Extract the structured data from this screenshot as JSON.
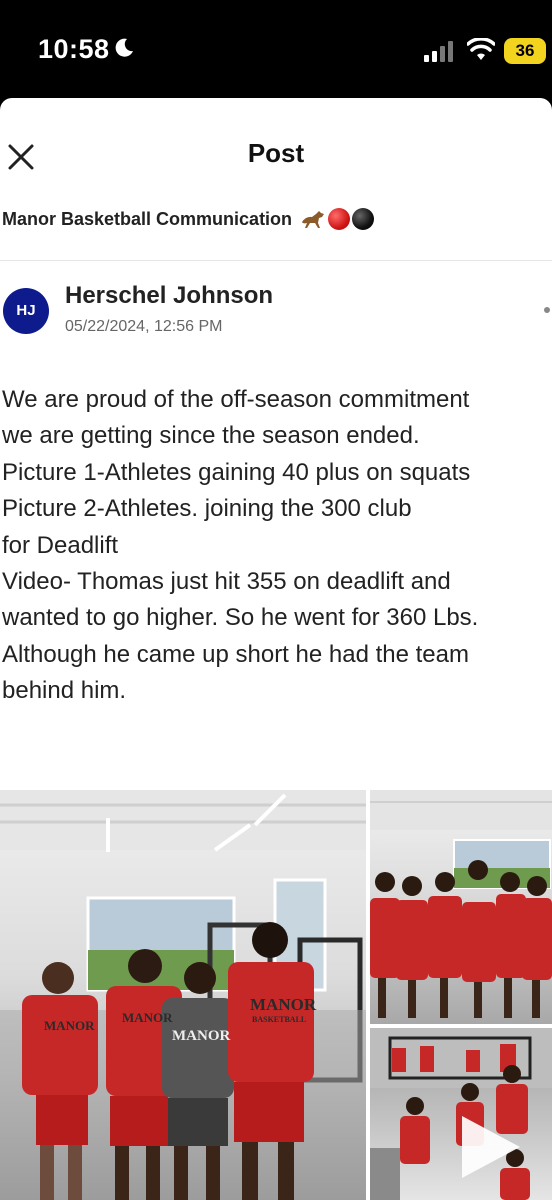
{
  "status_bar": {
    "time": "10:58",
    "battery": "36",
    "icons": [
      "moon-icon",
      "signal-icon",
      "wifi-icon",
      "battery-icon"
    ]
  },
  "header": {
    "title": "Post",
    "close_icon": "close-icon"
  },
  "group": {
    "name": "Manor Basketball Communication",
    "emojis": [
      "horse",
      "red-ball",
      "black-ball"
    ]
  },
  "post": {
    "avatar_initials": "HJ",
    "author": "Herschel Johnson",
    "timestamp": "05/22/2024, 12:56 PM",
    "body_lines": [
      "We are proud of the off-season commitment",
      "we are getting since the season ended.",
      "Picture 1-Athletes gaining 40 plus on squats",
      "Picture 2-Athletes. joining the 300 club",
      "for Deadlift",
      "Video- Thomas just hit 355 on deadlift and",
      "wanted to go higher. So he went for 360 Lbs.",
      "Although he came up short he had the team",
      "behind him."
    ]
  },
  "media": {
    "shirt_brand": "MANOR",
    "shirt_sub": "BASKETBALL",
    "play_icon": "play-icon"
  },
  "colors": {
    "avatar": "#0d1b8c",
    "jersey_red": "#c62828",
    "battery": "#f2d41f"
  }
}
